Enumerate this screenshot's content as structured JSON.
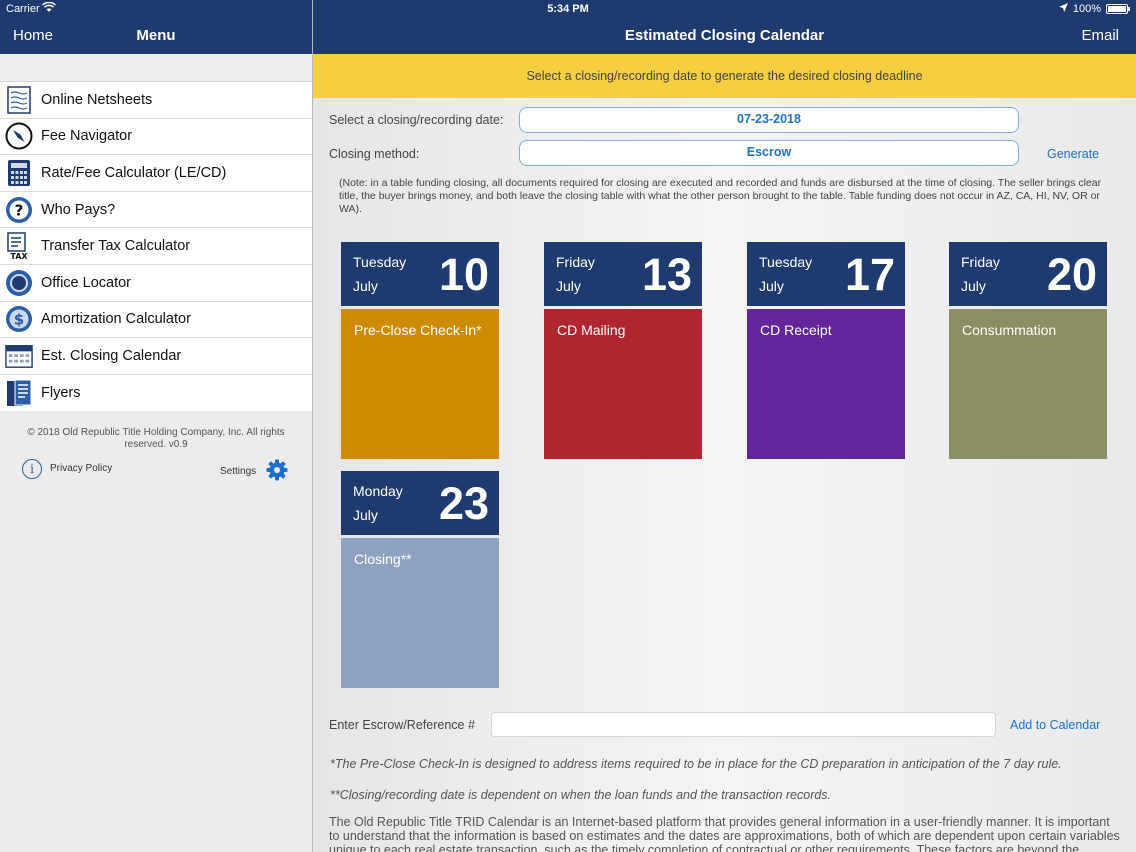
{
  "status_bar": {
    "carrier": "Carrier",
    "time": "5:34 PM",
    "battery": "100%",
    "battery_level": 1.0
  },
  "nav": {
    "home": "Home",
    "menu": "Menu",
    "title": "Estimated Closing Calendar",
    "email": "Email"
  },
  "sidebar": {
    "items": [
      {
        "label": "Online Netsheets",
        "icon": "netsheet-icon"
      },
      {
        "label": "Fee Navigator",
        "icon": "compass-icon"
      },
      {
        "label": "Rate/Fee Calculator (LE/CD)",
        "icon": "calculator-icon"
      },
      {
        "label": "Who Pays?",
        "icon": "question-icon"
      },
      {
        "label": "Transfer Tax Calculator",
        "icon": "tax-icon"
      },
      {
        "label": "Office Locator",
        "icon": "locator-icon"
      },
      {
        "label": "Amortization Calculator",
        "icon": "dollar-icon"
      },
      {
        "label": "Est. Closing Calendar",
        "icon": "calendar-icon"
      },
      {
        "label": "Flyers",
        "icon": "flyer-icon"
      }
    ],
    "copyright": "© 2018 Old Republic Title Holding Company, Inc. All rights reserved. v0.9",
    "privacy": "Privacy Policy",
    "settings": "Settings"
  },
  "main": {
    "banner": "Select a closing/recording date to generate the desired closing deadline",
    "date_label": "Select a closing/recording date:",
    "date_value": "07-23-2018",
    "method_label": "Closing method:",
    "method_value": "Escrow",
    "generate": "Generate",
    "note": "(Note: in a table funding closing, all documents required for closing are executed and recorded and funds are disbursed at the time of closing.  The seller brings clear title, the buyer brings money, and both leave the closing table with what the other person brought to the table.  Table funding does not occur in AZ, CA, HI, NV, OR or WA).",
    "cards": [
      {
        "weekday": "Tuesday",
        "month": "July",
        "day": "10",
        "event": "Pre-Close Check-In*",
        "color": "#cc8b00"
      },
      {
        "weekday": "Friday",
        "month": "July",
        "day": "13",
        "event": "CD Mailing",
        "color": "#b0252f"
      },
      {
        "weekday": "Tuesday",
        "month": "July",
        "day": "17",
        "event": "CD Receipt",
        "color": "#65259a"
      },
      {
        "weekday": "Friday",
        "month": "July",
        "day": "20",
        "event": "Consummation",
        "color": "#8b8e62"
      },
      {
        "weekday": "Monday",
        "month": "July",
        "day": "23",
        "event": "Closing**",
        "color": "#8fa1c0"
      }
    ],
    "ref_label": "Enter Escrow/Reference #",
    "ref_value": "",
    "add_to_calendar": "Add to Calendar",
    "footnote1": "*The Pre-Close Check-In is designed to address items required to be in place for the CD preparation in anticipation of the 7 day rule.",
    "footnote2": "**Closing/recording date is dependent on when the loan funds and the transaction records.",
    "disclaimer": "The Old Republic Title TRID Calendar is an Internet-based platform that provides general information in a user-friendly manner. It is important to understand that the information is based on estimates and the dates are approximations, both of which are dependent upon certain variables unique to each real estate transaction, such as the timely completion of contractual or other requirements. These factors are beyond the"
  }
}
